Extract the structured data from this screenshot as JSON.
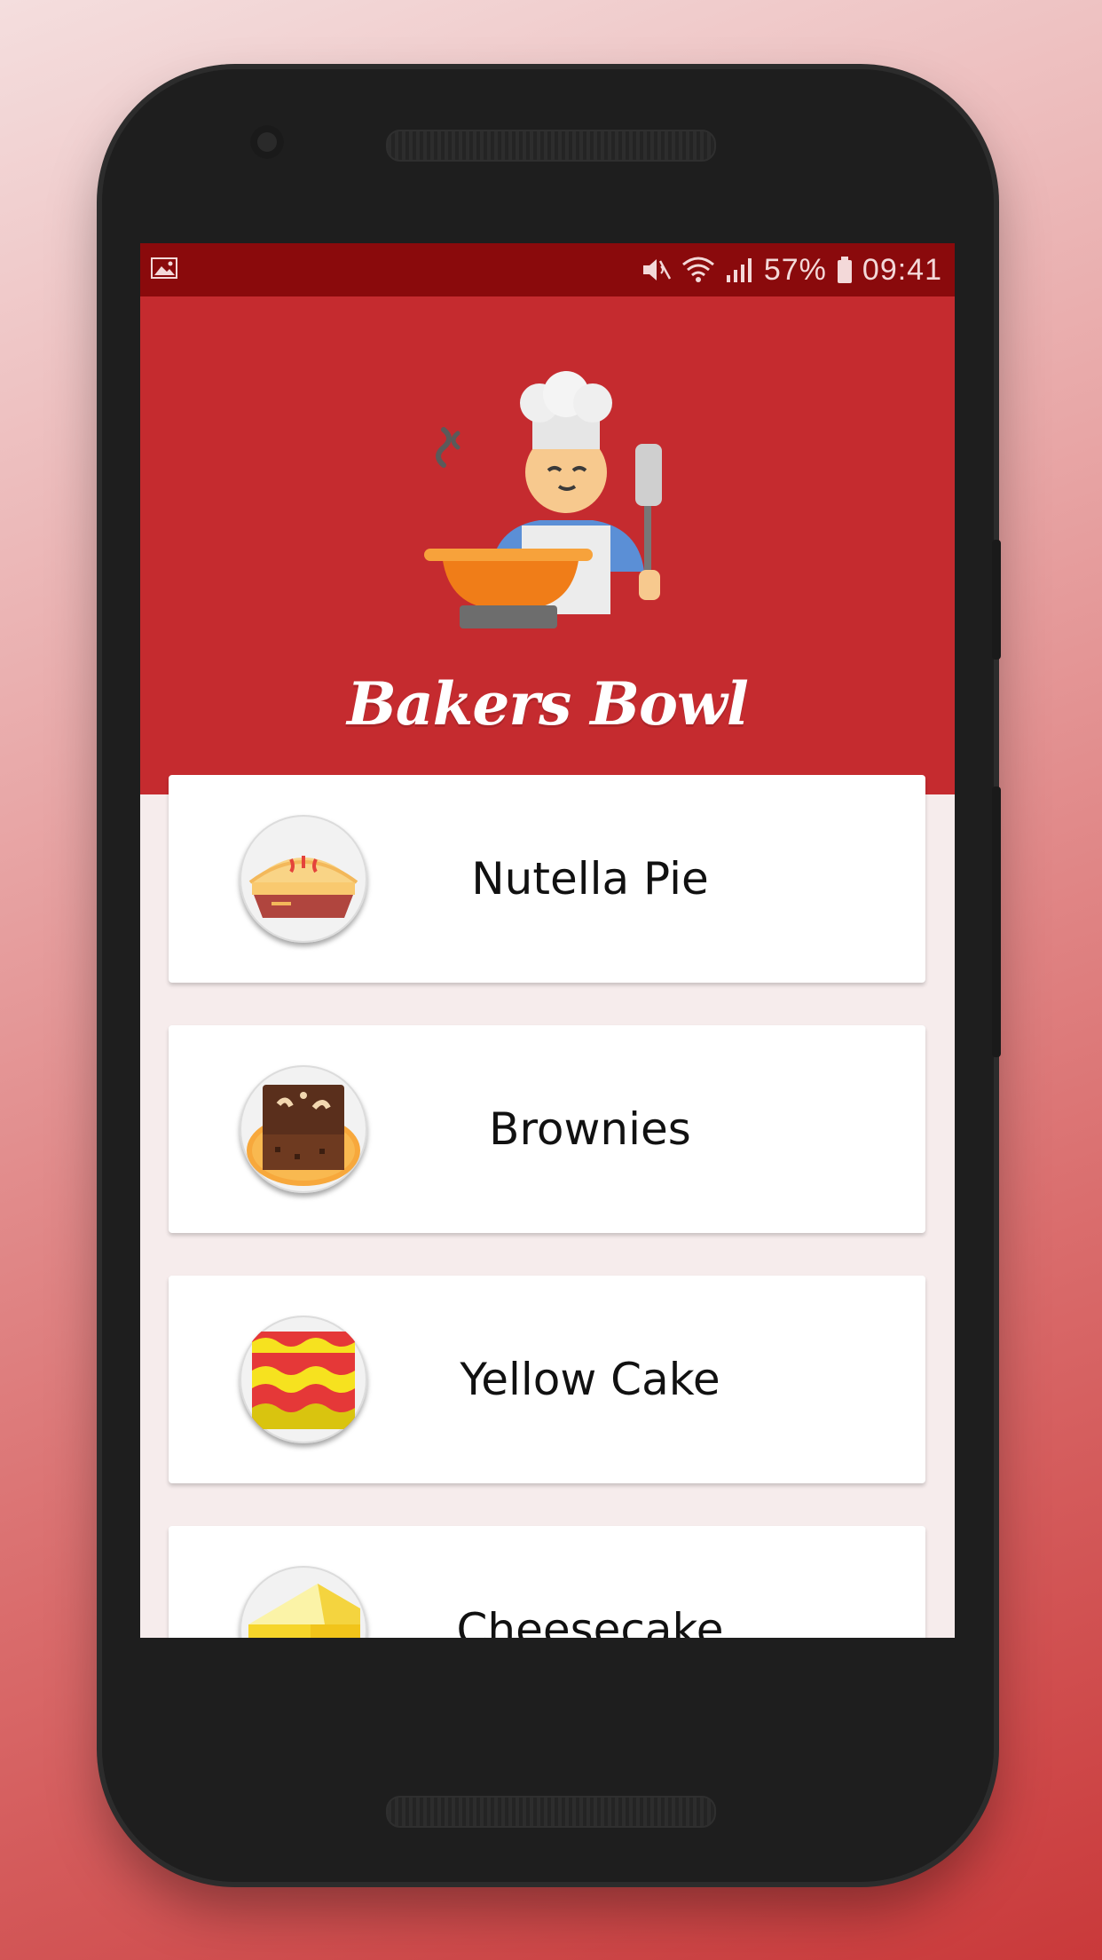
{
  "status_bar": {
    "battery": "57%",
    "time": "09:41",
    "icons": [
      "image-icon",
      "mute-icon",
      "wifi-icon",
      "signal-icon",
      "battery-icon"
    ]
  },
  "header": {
    "title": "Bakers Bowl",
    "illustration": "chef-icon"
  },
  "recipes": [
    {
      "name": "Nutella Pie",
      "icon": "pie-icon"
    },
    {
      "name": "Brownies",
      "icon": "brownie-icon"
    },
    {
      "name": "Yellow Cake",
      "icon": "yellow-cake-icon"
    },
    {
      "name": "Cheesecake",
      "icon": "cheesecake-icon"
    }
  ],
  "colors": {
    "primary": "#c52b2f",
    "status_bar": "#8a0a0c",
    "list_background": "#f6ecec"
  }
}
